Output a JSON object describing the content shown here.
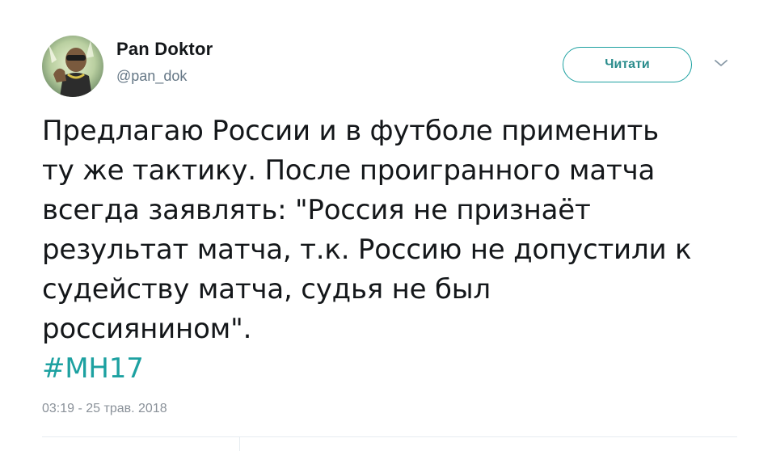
{
  "author": {
    "name": "Pan Doktor",
    "handle": "@pan_dok"
  },
  "follow_button": {
    "label": "Читати"
  },
  "tweet": {
    "lines": [
      "Предлагаю России и в футболе применить",
      "ту же тактику. После проигранного матча",
      "всегда заявлять: \"Россия не признаёт",
      "результат матча, т.к. Россию не допустили к",
      "судейству матча, судья не был",
      "россиянином\"."
    ],
    "hashtag": "#MH17",
    "timestamp": "03:19 - 25 трав. 2018"
  },
  "colors": {
    "accent": "#1da1a1",
    "text": "#14171a",
    "muted": "#657786"
  },
  "icons": {
    "menu": "chevron-down-icon",
    "avatar": "avatar"
  }
}
